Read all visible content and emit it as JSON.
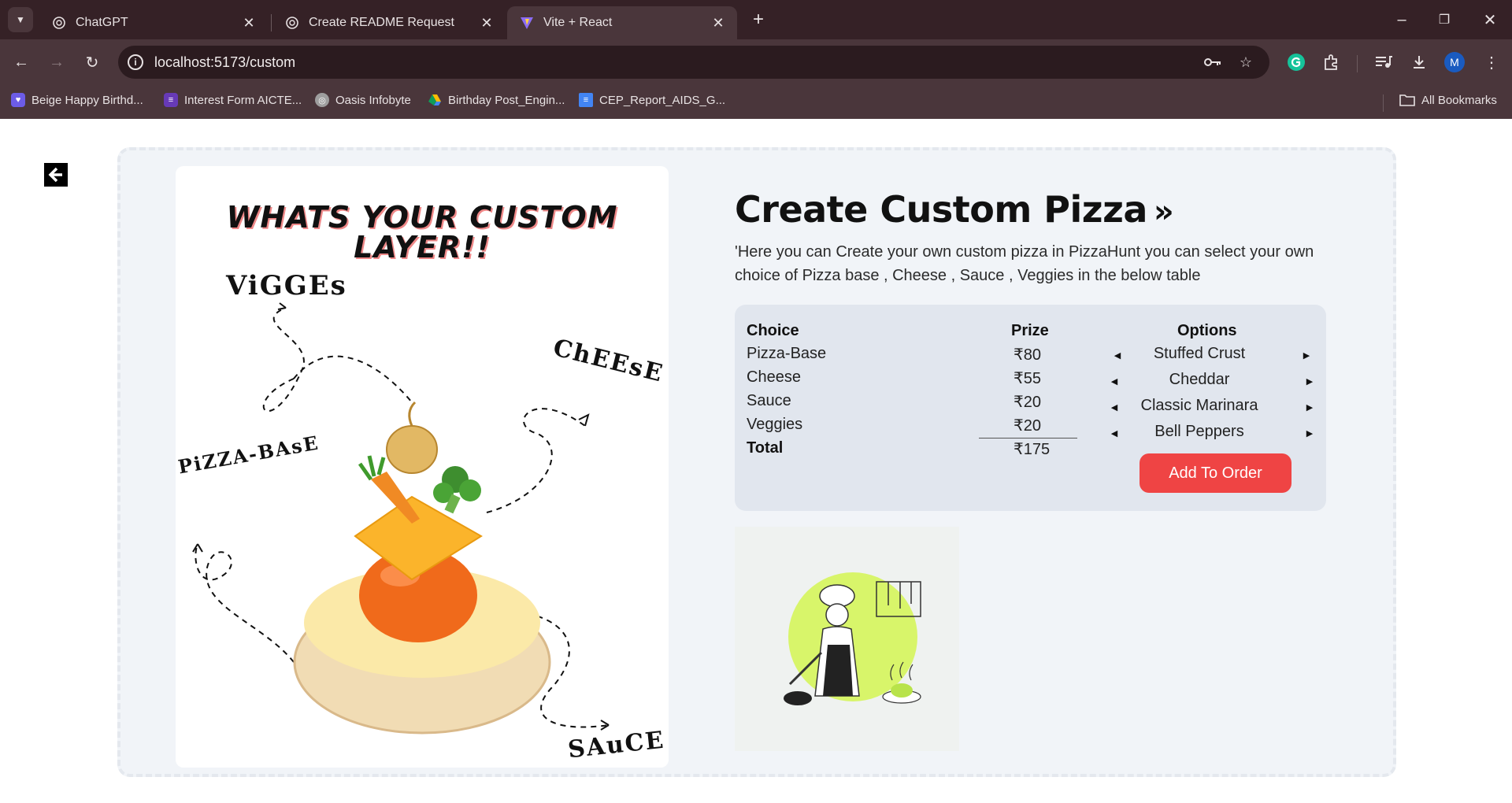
{
  "browser": {
    "tabs": [
      {
        "title": "ChatGPT",
        "icon": "openai-icon",
        "active": false
      },
      {
        "title": "Create README Request",
        "icon": "openai-icon",
        "active": false
      },
      {
        "title": "Vite + React",
        "icon": "vite-icon",
        "active": true
      }
    ],
    "address": "localhost:5173/custom",
    "profile_initial": "M",
    "bookmarks": [
      {
        "label": "Beige Happy Birthd...",
        "icon": "heart-icon",
        "color": "#6c5ce7"
      },
      {
        "label": "Interest Form AICTE...",
        "icon": "form-icon",
        "color": "#673ab7"
      },
      {
        "label": "Oasis Infobyte",
        "icon": "globe-icon",
        "color": "#9e9e9e"
      },
      {
        "label": "Birthday Post_Engin...",
        "icon": "drive-icon",
        "color": "#fbbc04"
      },
      {
        "label": "CEP_Report_AIDS_G...",
        "icon": "docs-icon",
        "color": "#4285f4"
      }
    ],
    "all_bookmarks": "All Bookmarks"
  },
  "poster": {
    "title_line1": "WHATS YOUR CUSTOM",
    "title_line2": "LAYER!!",
    "label_veggies": "ViGGEs",
    "label_cheese": "ChEEsE",
    "label_base": "PiZZA-BAsE",
    "label_sauce": "SAuCE"
  },
  "main": {
    "heading": "Create Custom Pizza",
    "heading_icon": "double-chevron-right-icon",
    "description": "'Here you can Create your own custom pizza in PizzaHunt you can select your own choice of Pizza base , Cheese , Sauce , Veggies in the below table"
  },
  "table": {
    "headers": {
      "choice": "Choice",
      "prize": "Prize",
      "options": "Options"
    },
    "rows": [
      {
        "choice": "Pizza-Base",
        "prize": "₹80",
        "option": "Stuffed Crust"
      },
      {
        "choice": "Cheese",
        "prize": "₹55",
        "option": "Cheddar"
      },
      {
        "choice": "Sauce",
        "prize": "₹20",
        "option": "Classic Marinara"
      },
      {
        "choice": "Veggies",
        "prize": "₹20",
        "option": "Bell Peppers"
      }
    ],
    "total_label": "Total",
    "total_value": "₹175",
    "add_button": "Add To Order"
  },
  "colors": {
    "accent": "#ef4444",
    "card": "#e1e6ee",
    "frame": "#f1f4f8",
    "chrome": "#4a363b"
  }
}
